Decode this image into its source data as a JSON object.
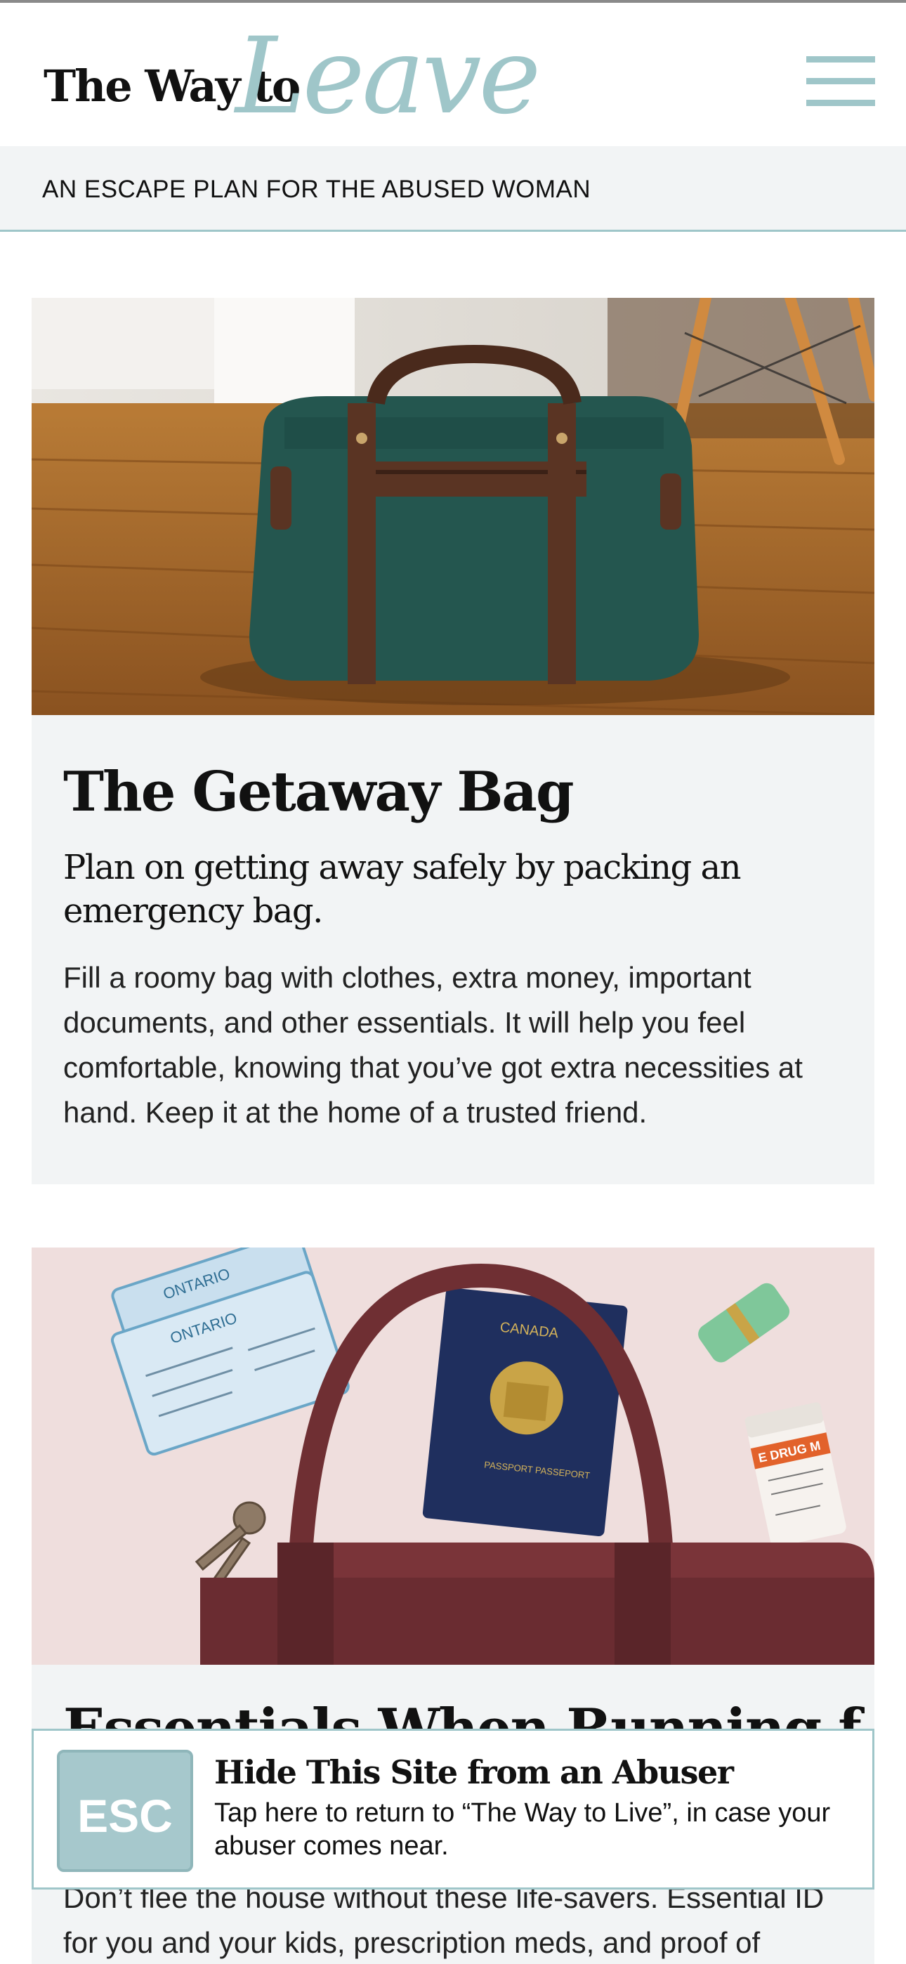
{
  "header": {
    "logo_text": "The Way to",
    "logo_script": "Leave",
    "menu_icon": "hamburger-menu-icon",
    "tagline": "AN ESCAPE PLAN FOR THE ABUSED WOMAN"
  },
  "articles": [
    {
      "image_subject": "green duffel bag on wooden floor",
      "title": "The Getaway Bag",
      "subtitle": "Plan on getting away safely by packing an emergency bag.",
      "body": "Fill a roomy bag with clothes, extra money, important documents, and other essentials. It will help you feel comfortable, knowing that you’ve got extra necessities at hand. Keep it at the home of a trusted friend."
    },
    {
      "image_subject": "purse with passport, ID cards, keys, cash and prescription bottle",
      "title": "Essentials When Running f",
      "body": "Don’t flee the house without these life-savers. Essential ID for you and your kids, prescription meds, and proof of",
      "photo_text": {
        "id_card_label": "ONTARIO",
        "passport_country": "CANADA",
        "passport_label": "PASSPORT PASSEPORT",
        "pill_label": "E DRUG M"
      }
    }
  ],
  "esc_panel": {
    "badge": "ESC",
    "title": "Hide This Site from an Abuser",
    "text": "Tap here to return to “The Way to Live”, in case your abuser comes near."
  },
  "colors": {
    "accent": "#9fc6c9",
    "card_bg": "#f2f4f5",
    "text": "#111111"
  }
}
